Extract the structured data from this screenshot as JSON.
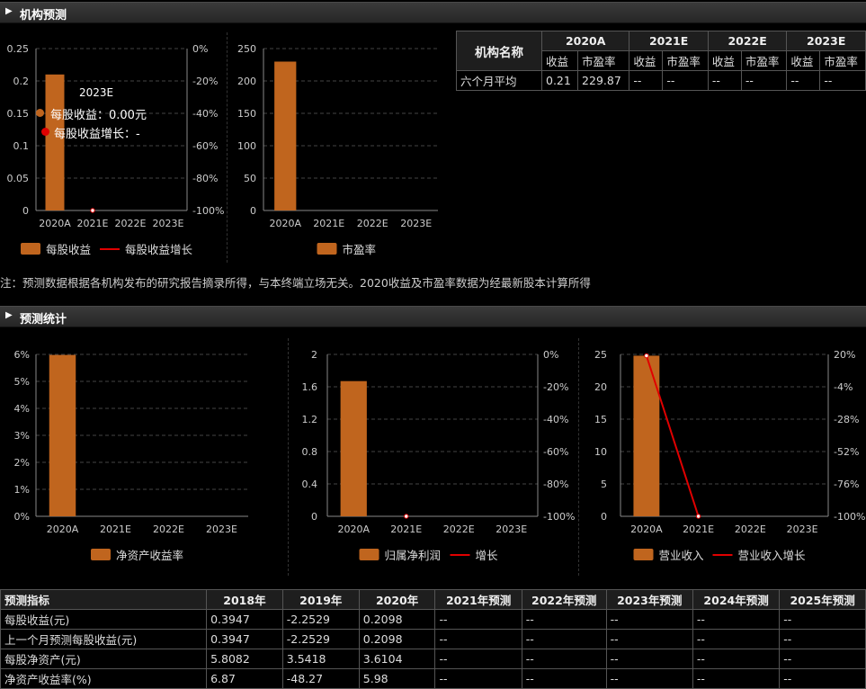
{
  "sections": {
    "forecast_title": "机构预测",
    "stats_title": "预测统计"
  },
  "note": "注：预测数据根据各机构发布的研究报告摘录所得，与本终端立场无关。2020收益及市盈率数据为经最新股本计算所得",
  "tooltip": {
    "year": "2023E",
    "eps_label": "每股收益：0.00元",
    "growth_label": "每股收益增长：-"
  },
  "colors": {
    "bar": "#c0651e",
    "line": "#e00000",
    "grid": "#444444"
  },
  "forecast_table": {
    "name_header": "机构名称",
    "years": [
      "2020A",
      "2021E",
      "2022E",
      "2023E"
    ],
    "sub_headers": [
      "收益",
      "市盈率"
    ],
    "rows": [
      {
        "name": "六个月平均",
        "values": [
          "0.21",
          "229.87",
          "--",
          "--",
          "--",
          "--",
          "--",
          "--"
        ]
      }
    ]
  },
  "stats_table": {
    "headers": [
      "预测指标",
      "2018年",
      "2019年",
      "2020年",
      "2021年预测",
      "2022年预测",
      "2023年预测",
      "2024年预测",
      "2025年预测"
    ],
    "rows": [
      {
        "label": "每股收益(元)",
        "values": [
          "0.3947",
          "-2.2529",
          "0.2098",
          "--",
          "--",
          "--",
          "--",
          "--"
        ]
      },
      {
        "label": "上一个月预测每股收益(元)",
        "values": [
          "0.3947",
          "-2.2529",
          "0.2098",
          "--",
          "--",
          "--",
          "--",
          "--"
        ]
      },
      {
        "label": "每股净资产(元)",
        "values": [
          "5.8082",
          "3.5418",
          "3.6104",
          "--",
          "--",
          "--",
          "--",
          "--"
        ]
      },
      {
        "label": "净资产收益率(%)",
        "values": [
          "6.87",
          "-48.27",
          "5.98",
          "--",
          "--",
          "--",
          "--",
          "--"
        ]
      }
    ]
  },
  "chart_data": [
    {
      "type": "bar",
      "categories": [
        "2020A",
        "2021E",
        "2022E",
        "2023E"
      ],
      "series": [
        {
          "name": "每股收益",
          "type": "bar",
          "values": [
            0.21,
            null,
            null,
            null
          ]
        },
        {
          "name": "每股收益增长",
          "type": "line",
          "values": [
            null,
            -100,
            null,
            null
          ]
        }
      ],
      "y_ticks": [
        "0",
        "0.05",
        "0.1",
        "0.15",
        "0.2",
        "0.25"
      ],
      "ylim": [
        0,
        0.25
      ],
      "y2_ticks": [
        "-100%",
        "-80%",
        "-60%",
        "-40%",
        "-20%",
        "0%"
      ],
      "y2lim": [
        -100,
        0
      ],
      "grid": true,
      "legend": "bottom"
    },
    {
      "type": "bar",
      "categories": [
        "2020A",
        "2021E",
        "2022E",
        "2023E"
      ],
      "series": [
        {
          "name": "市盈率",
          "type": "bar",
          "values": [
            229.87,
            null,
            null,
            null
          ]
        }
      ],
      "y_ticks": [
        "0",
        "50",
        "100",
        "150",
        "200",
        "250"
      ],
      "ylim": [
        0,
        250
      ],
      "grid": true,
      "legend": "bottom"
    },
    {
      "type": "bar",
      "categories": [
        "2020A",
        "2021E",
        "2022E",
        "2023E"
      ],
      "series": [
        {
          "name": "净资产收益率",
          "type": "bar",
          "values": [
            5.98,
            null,
            null,
            null
          ]
        }
      ],
      "y_ticks": [
        "0%",
        "1%",
        "2%",
        "3%",
        "4%",
        "5%",
        "6%"
      ],
      "ylim": [
        0,
        6
      ],
      "grid": true,
      "legend": "bottom"
    },
    {
      "type": "bar",
      "categories": [
        "2020A",
        "2021E",
        "2022E",
        "2023E"
      ],
      "series": [
        {
          "name": "归属净利润",
          "type": "bar",
          "values": [
            1.67,
            null,
            null,
            null
          ]
        },
        {
          "name": "增长",
          "type": "line",
          "values": [
            null,
            -100,
            null,
            null
          ]
        }
      ],
      "y_ticks": [
        "0",
        "0.4",
        "0.8",
        "1.2",
        "1.6",
        "2"
      ],
      "ylim": [
        0,
        2
      ],
      "y2_ticks": [
        "-100%",
        "-80%",
        "-60%",
        "-40%",
        "-20%",
        "0%"
      ],
      "y2lim": [
        -100,
        0
      ],
      "grid": true,
      "legend": "bottom"
    },
    {
      "type": "bar",
      "categories": [
        "2020A",
        "2021E",
        "2022E",
        "2023E"
      ],
      "series": [
        {
          "name": "营业收入",
          "type": "bar",
          "values": [
            24.8,
            null,
            null,
            null
          ]
        },
        {
          "name": "营业收入增长",
          "type": "line",
          "values": [
            19,
            -100,
            null,
            null
          ]
        }
      ],
      "y_ticks": [
        "0",
        "5",
        "10",
        "15",
        "20",
        "25"
      ],
      "ylim": [
        0,
        25
      ],
      "y2_ticks": [
        "-100%",
        "-76%",
        "-52%",
        "-28%",
        "-4%",
        "20%"
      ],
      "y2lim": [
        -100,
        20
      ],
      "grid": true,
      "legend": "bottom"
    }
  ]
}
